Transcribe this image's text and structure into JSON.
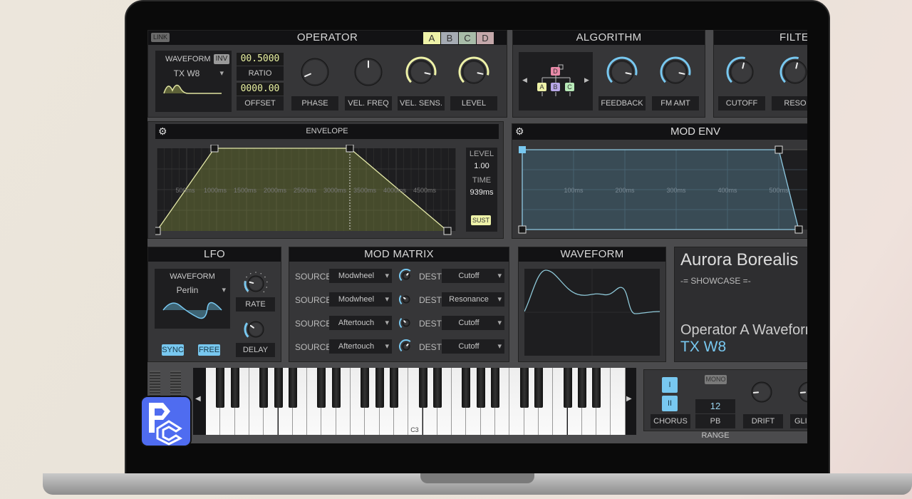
{
  "colors": {
    "accent_yellow": "#eef2a8",
    "accent_blue": "#78c8f0"
  },
  "operator": {
    "title": "OPERATOR",
    "link": "LINK",
    "tabs": [
      "A",
      "B",
      "C",
      "D"
    ],
    "active_tab": "A",
    "waveform_label": "WAVEFORM",
    "inv": "INV",
    "waveform_value": "TX W8",
    "ratio_value": "00.5000",
    "ratio_label": "RATIO",
    "offset_value": "0000.00",
    "offset_label": "OFFSET",
    "knobs": [
      {
        "label": "PHASE",
        "value": 0.08
      },
      {
        "label": "VEL. FREQ",
        "value": 0.5
      },
      {
        "label": "VEL. SENS.",
        "value": 0.88
      },
      {
        "label": "LEVEL",
        "value": 0.88
      }
    ]
  },
  "algorithm": {
    "title": "ALGORITHM",
    "ops": [
      "D",
      "A",
      "B",
      "C"
    ],
    "knobs": [
      {
        "label": "FEEDBACK",
        "value": 0.88
      },
      {
        "label": "FM AMT",
        "value": 0.88
      }
    ]
  },
  "filter": {
    "title": "FILTER",
    "knobs": [
      {
        "label": "CUTOFF",
        "value": 0.55
      },
      {
        "label": "RESO",
        "value": 0.55
      }
    ]
  },
  "envelope": {
    "title": "ENVELOPE",
    "ticks": [
      "500ms",
      "1000ms",
      "1500ms",
      "2000ms",
      "2500ms",
      "3000ms",
      "3500ms",
      "4000ms",
      "4500ms"
    ],
    "level_label": "LEVEL",
    "level_value": "1.00",
    "time_label": "TIME",
    "time_value": "939ms",
    "sust": "SUST"
  },
  "mod_env": {
    "title": "MOD ENV",
    "ticks": [
      "100ms",
      "200ms",
      "300ms",
      "400ms",
      "500ms"
    ]
  },
  "lfo": {
    "title": "LFO",
    "waveform_label": "WAVEFORM",
    "waveform_value": "Perlin",
    "rate_label": "RATE",
    "rate_value": 0.22,
    "delay_label": "DELAY",
    "delay_value": 0.3,
    "sync": "SYNC",
    "free": "FREE"
  },
  "mod_matrix": {
    "title": "MOD MATRIX",
    "source_label": "SOURCE",
    "dest_label": "DEST",
    "rows": [
      {
        "source": "Modwheel",
        "amount": 0.65,
        "dest": "Cutoff"
      },
      {
        "source": "Modwheel",
        "amount": 0.3,
        "dest": "Resonance"
      },
      {
        "source": "Aftertouch",
        "amount": 0.33,
        "dest": "Cutoff"
      },
      {
        "source": "Aftertouch",
        "amount": 0.65,
        "dest": "Cutoff"
      }
    ]
  },
  "waveform_view": {
    "title": "WAVEFORM"
  },
  "preset": {
    "name": "Aurora Borealis",
    "category": "-= SHOWCASE =-",
    "param_name": "Operator A Waveform",
    "param_value": "TX W8"
  },
  "keyboard": {
    "octave_label": "C3"
  },
  "performance": {
    "chorus_i": "I",
    "chorus_ii": "II",
    "chorus_label": "CHORUS",
    "mono": "MONO",
    "pb_range_value": "12",
    "pb_range_label": "PB RANGE",
    "drift_label": "DRIFT",
    "drift_value": 0.15,
    "glide_label": "GLIDE"
  }
}
